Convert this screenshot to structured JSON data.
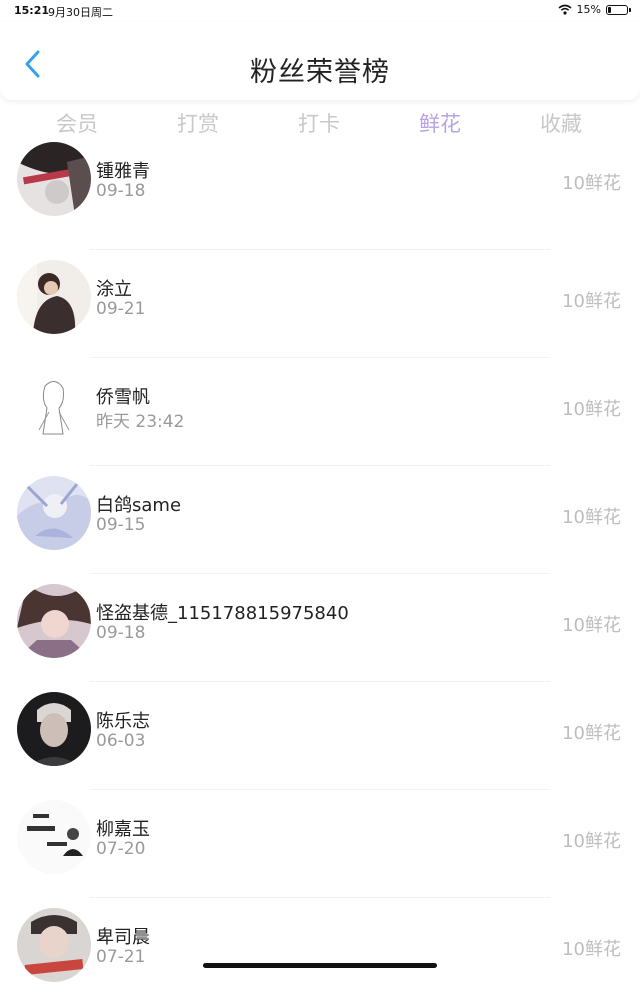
{
  "status": {
    "time": "15:21",
    "date": "9月30日周二",
    "battery": "15%",
    "battery_level": 0.15
  },
  "header": {
    "title": "粉丝荣誉榜"
  },
  "tabs": [
    {
      "label": "会员"
    },
    {
      "label": "打赏"
    },
    {
      "label": "打卡"
    },
    {
      "label": "鲜花",
      "active": true
    },
    {
      "label": "收藏"
    }
  ],
  "fans": [
    {
      "name": "锺雅青",
      "date": "09-18",
      "amount": "10鲜花"
    },
    {
      "name": "涂立",
      "date": "09-21",
      "amount": "10鲜花"
    },
    {
      "name": "侨雪帆",
      "date": "昨天 23:42",
      "amount": "10鲜花"
    },
    {
      "name": "白鸽same",
      "date": "09-15",
      "amount": "10鲜花"
    },
    {
      "name": "怪盗基德_115178815975840",
      "date": "09-18",
      "amount": "10鲜花"
    },
    {
      "name": "陈乐志",
      "date": "06-03",
      "amount": "10鲜花"
    },
    {
      "name": "柳嘉玉",
      "date": "07-20",
      "amount": "10鲜花"
    },
    {
      "name": "卑司晨",
      "date": "07-21",
      "amount": "10鲜花"
    }
  ]
}
